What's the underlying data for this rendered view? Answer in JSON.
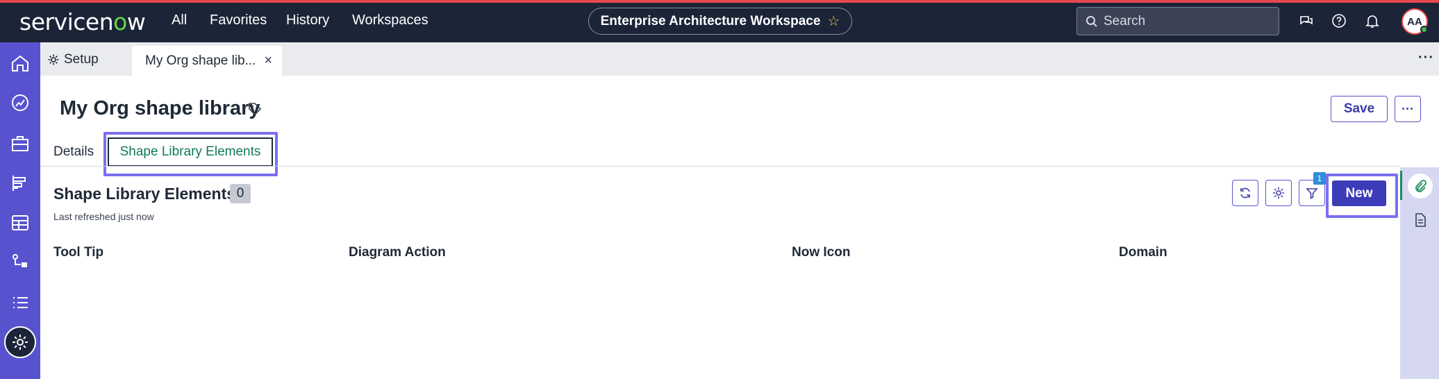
{
  "topbar": {
    "logo_text_a": "servicen",
    "logo_text_o": "o",
    "logo_text_b": "w",
    "nav": [
      "All",
      "Favorites",
      "History",
      "Workspaces"
    ],
    "workspace_title": "Enterprise Architecture Workspace",
    "search_placeholder": "Search",
    "avatar_initials": "AA",
    "accent_color": "#e5484d",
    "icons": [
      "chat-icon",
      "help-icon",
      "bell-icon"
    ]
  },
  "rail": {
    "icons": [
      "home-icon",
      "dashboard-icon",
      "briefcase-icon",
      "roadmap-icon",
      "database-icon",
      "flow-icon",
      "list-icon",
      "settings-icon"
    ],
    "color": "#5753cf"
  },
  "tabs": {
    "setup_label": "Setup",
    "active_label": "My Org shape lib...",
    "close": "×",
    "more": "···"
  },
  "page": {
    "title": "My Org shape library",
    "save_label": "Save",
    "more_label": "···"
  },
  "form_tabs": {
    "details": "Details",
    "shape_library_elements": "Shape Library Elements"
  },
  "related_list": {
    "title": "Shape Library Elements",
    "count": "0",
    "refreshed": "Last refreshed just now",
    "filter_count": "1",
    "new_label": "New",
    "columns": [
      "Tool Tip",
      "Diagram Action",
      "Now Icon",
      "Domain"
    ]
  }
}
